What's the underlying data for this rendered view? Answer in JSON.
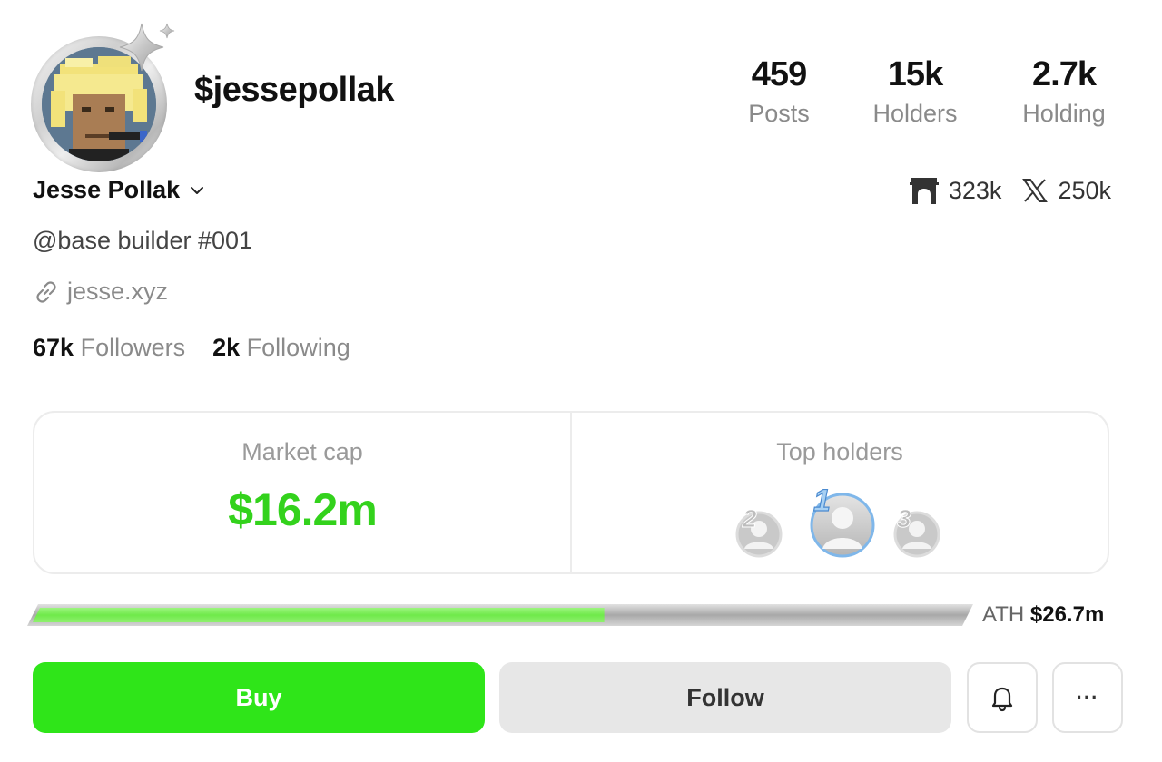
{
  "profile": {
    "handle": "$jessepollak",
    "name": "Jesse Pollak",
    "bio": "@base builder #001",
    "website": "jesse.xyz"
  },
  "stats": [
    {
      "value": "459",
      "label": "Posts"
    },
    {
      "value": "15k",
      "label": "Holders"
    },
    {
      "value": "2.7k",
      "label": "Holding"
    }
  ],
  "social": {
    "farcaster_count": "323k",
    "x_count": "250k",
    "farcaster_icon": "farcaster-arch-icon",
    "x_icon": "x-logo-icon"
  },
  "follow": {
    "followers_count": "67k",
    "followers_label": "Followers",
    "following_count": "2k",
    "following_label": "Following"
  },
  "market": {
    "title": "Market cap",
    "value": "$16.2m",
    "value_color": "#33d21c"
  },
  "top_holders": {
    "title": "Top holders",
    "ranks": [
      "2",
      "1",
      "3"
    ]
  },
  "progress": {
    "fraction": 0.61,
    "ath_label": "ATH",
    "ath_value": "$26.7m",
    "fill_color": "#7ef35a"
  },
  "actions": {
    "buy_label": "Buy",
    "follow_label": "Follow",
    "more_label": "···",
    "buy_color": "#2fe519"
  }
}
